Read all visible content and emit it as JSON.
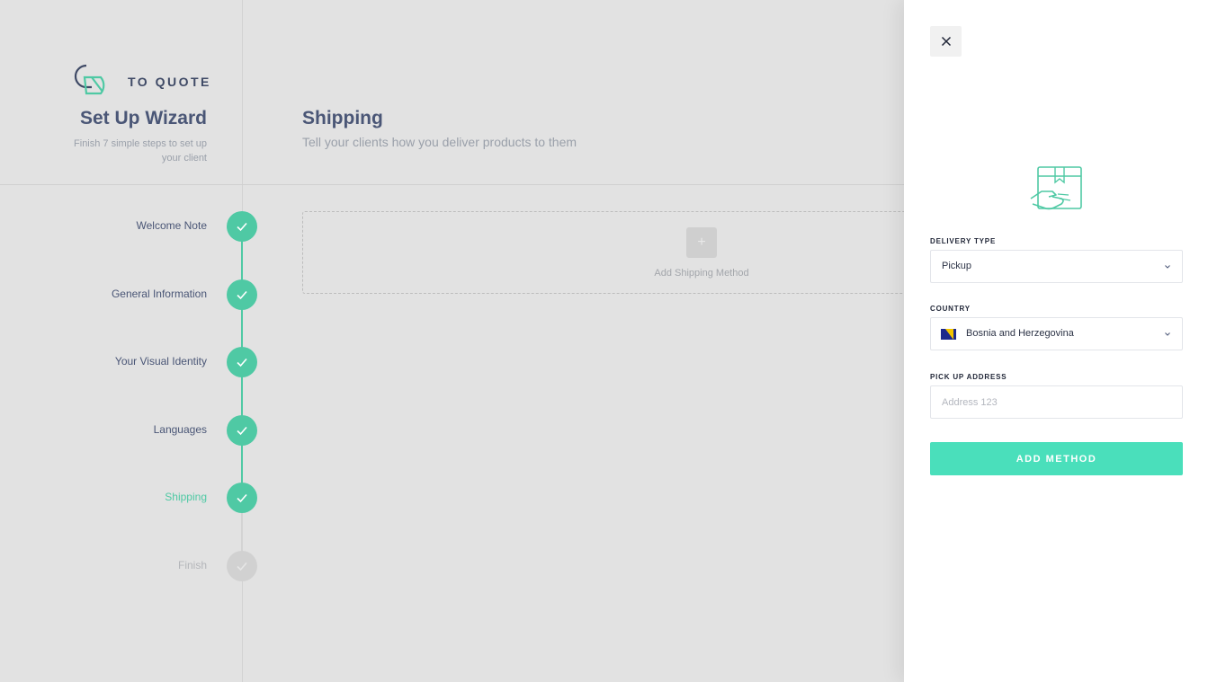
{
  "brand": {
    "name": "TO QUOTE"
  },
  "wizard": {
    "title": "Set Up Wizard",
    "subtitle": "Finish 7 simple steps to set up your client",
    "steps": [
      {
        "label": "Welcome Note",
        "status": "done"
      },
      {
        "label": "General Information",
        "status": "done"
      },
      {
        "label": "Your Visual Identity",
        "status": "done"
      },
      {
        "label": "Languages",
        "status": "done"
      },
      {
        "label": "Shipping",
        "status": "active"
      },
      {
        "label": "Finish",
        "status": "pending"
      }
    ]
  },
  "main": {
    "title": "Shipping",
    "subtitle": "Tell your clients how you deliver products to them",
    "add_plus": "+",
    "add_label": "Add Shipping Method"
  },
  "panel": {
    "delivery_type_label": "DELIVERY TYPE",
    "delivery_type_value": "Pickup",
    "country_label": "COUNTRY",
    "country_value": "Bosnia and Herzegovina",
    "pickup_address_label": "PICK UP ADDRESS",
    "pickup_address_value": "",
    "pickup_address_placeholder": "Address 123",
    "submit_label": "ADD METHOD"
  },
  "colors": {
    "accent": "#4fc9a4",
    "button": "#4adfbb",
    "text_dark": "#4a5676",
    "muted": "#9aa0aa"
  },
  "icons": {
    "logo": "to-quote-logo",
    "check": "check-icon",
    "close": "close-icon",
    "chevron": "chevron-down-icon",
    "package": "package-handover-icon",
    "flag": "bosnia-flag-icon"
  }
}
